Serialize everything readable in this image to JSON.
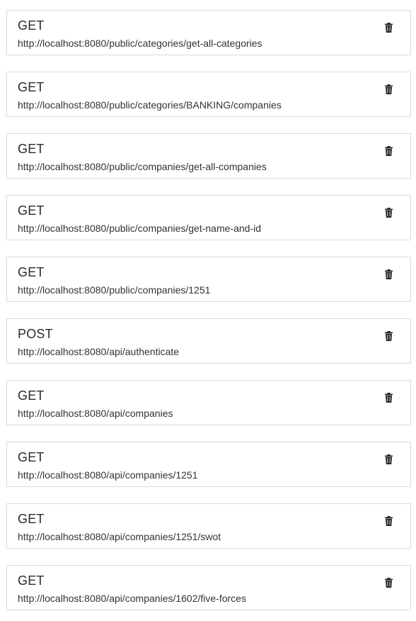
{
  "requests": [
    {
      "method": "GET",
      "url": "http://localhost:8080/public/categories/get-all-categories",
      "delete_icon": "trash-icon"
    },
    {
      "method": "GET",
      "url": "http://localhost:8080/public/categories/BANKING/companies",
      "delete_icon": "trash-icon"
    },
    {
      "method": "GET",
      "url": "http://localhost:8080/public/companies/get-all-companies",
      "delete_icon": "trash-icon"
    },
    {
      "method": "GET",
      "url": "http://localhost:8080/public/companies/get-name-and-id",
      "delete_icon": "trash-icon"
    },
    {
      "method": "GET",
      "url": "http://localhost:8080/public/companies/1251",
      "delete_icon": "trash-icon"
    },
    {
      "method": "POST",
      "url": "http://localhost:8080/api/authenticate",
      "delete_icon": "trash-icon"
    },
    {
      "method": "GET",
      "url": "http://localhost:8080/api/companies",
      "delete_icon": "trash-icon"
    },
    {
      "method": "GET",
      "url": "http://localhost:8080/api/companies/1251",
      "delete_icon": "trash-icon"
    },
    {
      "method": "GET",
      "url": "http://localhost:8080/api/companies/1251/swot",
      "delete_icon": "trash-icon"
    },
    {
      "method": "GET",
      "url": "http://localhost:8080/api/companies/1602/five-forces",
      "delete_icon": "trash-icon"
    }
  ],
  "colors": {
    "border": "#d9d9d9",
    "text": "#2b2b2b",
    "icon": "#222222"
  }
}
